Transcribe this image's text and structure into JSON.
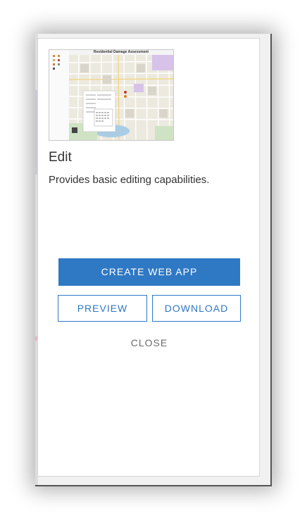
{
  "card": {
    "thumbnail_caption": "Residential Damage Assessment",
    "title": "Edit",
    "description": "Provides basic editing capabilities."
  },
  "actions": {
    "create_label": "CREATE WEB APP",
    "preview_label": "PREVIEW",
    "download_label": "DOWNLOAD",
    "close_label": "CLOSE"
  },
  "colors": {
    "accent": "#2f78c4",
    "text": "#323232",
    "muted": "#6b6b6b"
  }
}
